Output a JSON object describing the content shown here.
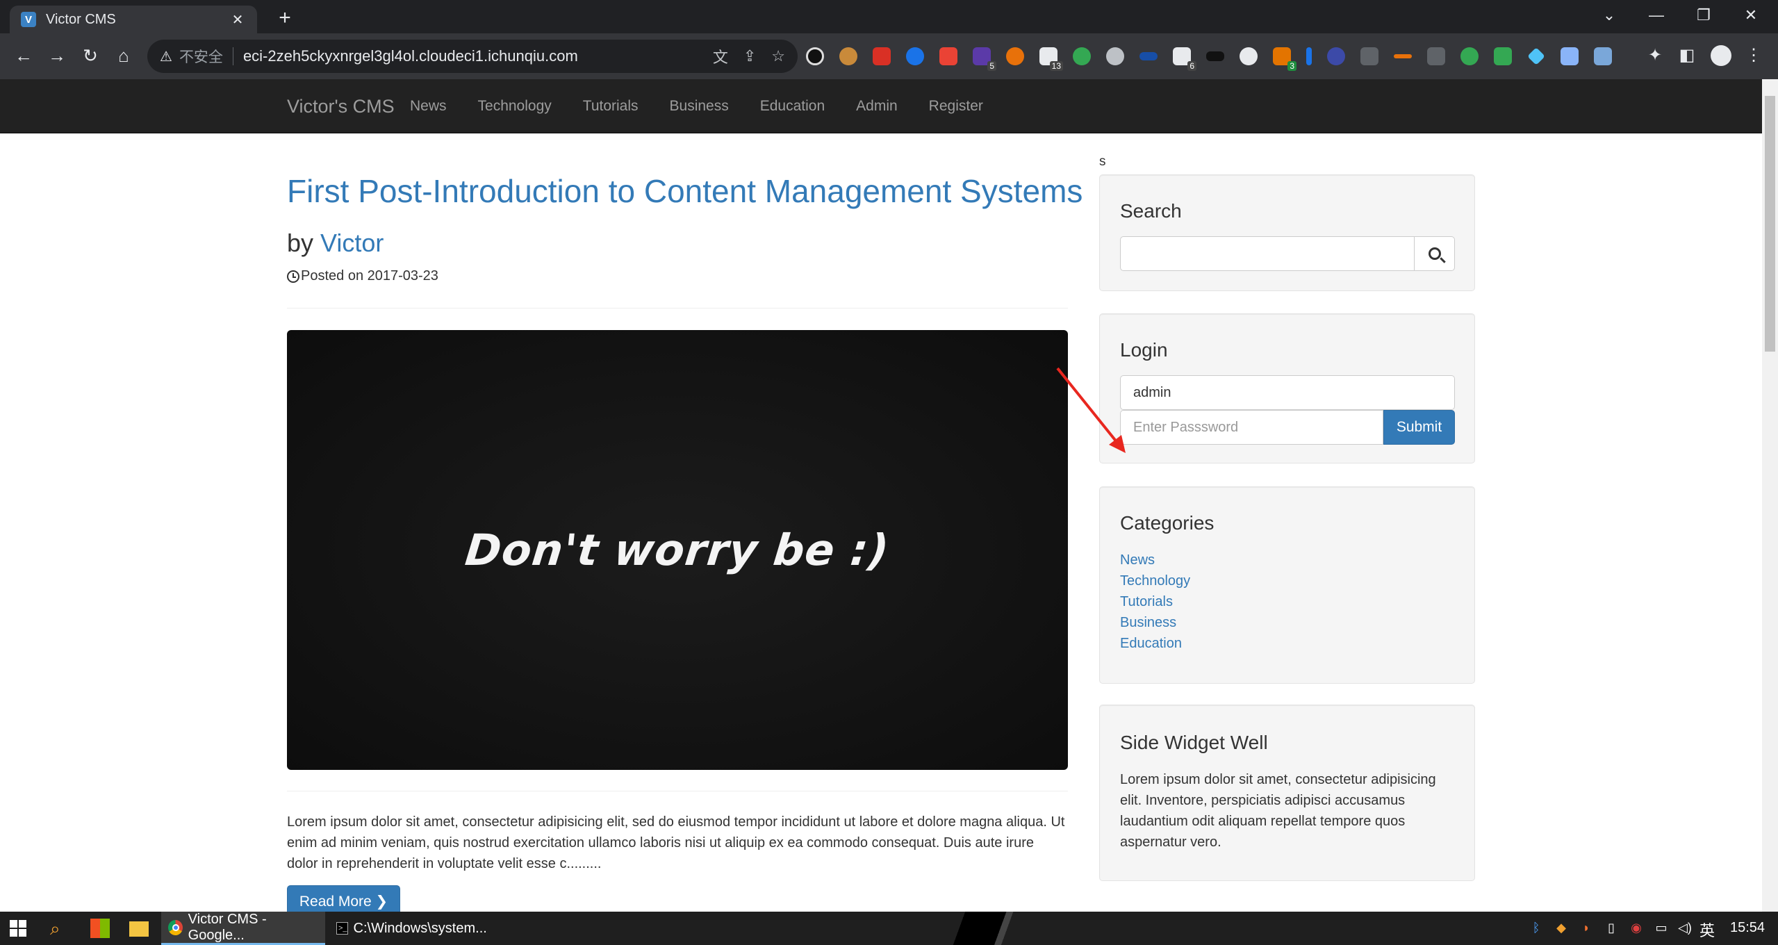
{
  "browser": {
    "tab_title": "Victor CMS",
    "tab_favicon_letter": "V",
    "close_tab": "✕",
    "new_tab": "+",
    "insecure_label": "不安全",
    "url": "eci-2zeh5ckyxnrgel3gl4ol.cloudeci1.ichunqiu.com",
    "extension_badges": [
      "5",
      "13",
      "6",
      "3"
    ]
  },
  "site": {
    "brand": "Victor's CMS",
    "nav": [
      "News",
      "Technology",
      "Tutorials",
      "Business",
      "Education",
      "Admin",
      "Register"
    ]
  },
  "post": {
    "title": "First Post-Introduction to Content Management Systems",
    "by_prefix": "by ",
    "author": "Victor",
    "posted": "Posted on 2017-03-23",
    "image_text": "Don't worry be :)",
    "excerpt": "Lorem ipsum dolor sit amet, consectetur adipisicing elit, sed do eiusmod tempor incididunt ut labore et dolore magna aliqua. Ut enim ad minim veniam, quis nostrud exercitation ullamco laboris nisi ut aliquip ex ea commodo consequat. Duis aute irure dolor in reprehenderit in voluptate velit esse c.........",
    "read_more": "Read More ❯"
  },
  "sidebar": {
    "stray_text": "s",
    "search": {
      "heading": "Search",
      "value": ""
    },
    "login": {
      "heading": "Login",
      "username_value": "admin",
      "password_placeholder": "Enter Passsword",
      "submit": "Submit"
    },
    "categories": {
      "heading": "Categories",
      "items": [
        "News",
        "Technology",
        "Tutorials",
        "Business",
        "Education"
      ]
    },
    "widget": {
      "heading": "Side Widget Well",
      "text": "Lorem ipsum dolor sit amet, consectetur adipisicing elit. Inventore, perspiciatis adipisci accusamus laudantium odit aliquam repellat tempore quos aspernatur vero."
    }
  },
  "taskbar": {
    "chrome_task": "Victor CMS - Google...",
    "cmd_task": "C:\\Windows\\system...",
    "ime": "英",
    "time": "15:54"
  },
  "colors": {
    "link": "#337ab7",
    "navbar": "#222222",
    "annotation_arrow": "#e8271f"
  }
}
